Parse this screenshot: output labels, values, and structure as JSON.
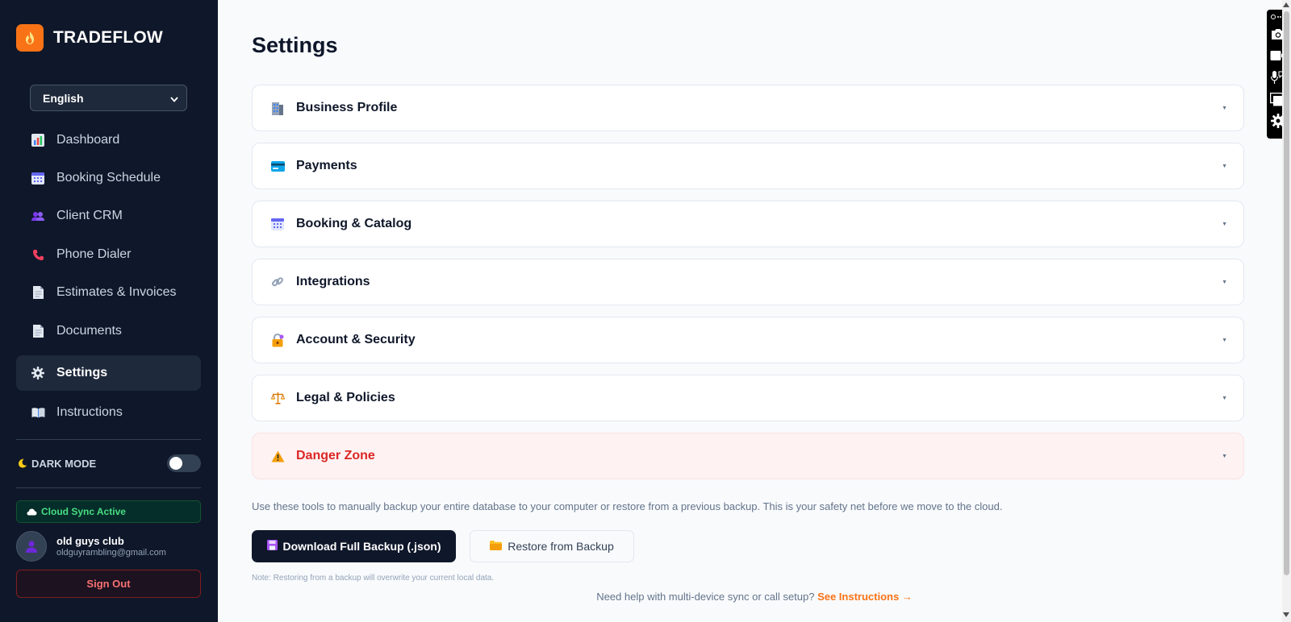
{
  "brand": {
    "name": "TRADEFLOW",
    "icon": "flame-icon"
  },
  "language": {
    "selected": "English"
  },
  "nav": {
    "items": [
      {
        "label": "Dashboard",
        "icon": "bar-chart-icon"
      },
      {
        "label": "Booking Schedule",
        "icon": "calendar-icon"
      },
      {
        "label": "Client CRM",
        "icon": "users-icon"
      },
      {
        "label": "Phone Dialer",
        "icon": "phone-icon"
      },
      {
        "label": "Estimates & Invoices",
        "icon": "document-icon"
      },
      {
        "label": "Documents",
        "icon": "document-icon"
      },
      {
        "label": "Settings",
        "icon": "gear-icon",
        "active": true
      },
      {
        "label": "Instructions",
        "icon": "book-icon"
      }
    ]
  },
  "dark_mode": {
    "label": "DARK MODE",
    "enabled": false
  },
  "sync": {
    "label": "Cloud Sync Active"
  },
  "user": {
    "name": "old guys club",
    "email": "oldguyrambling@gmail.com"
  },
  "signout": {
    "label": "Sign Out"
  },
  "page": {
    "title": "Settings"
  },
  "sections": [
    {
      "label": "Business Profile",
      "icon": "building-icon"
    },
    {
      "label": "Payments",
      "icon": "credit-card-icon"
    },
    {
      "label": "Booking & Catalog",
      "icon": "calendar-icon"
    },
    {
      "label": "Integrations",
      "icon": "link-icon"
    },
    {
      "label": "Account & Security",
      "icon": "lock-icon"
    },
    {
      "label": "Legal & Policies",
      "icon": "scales-icon"
    },
    {
      "label": "Danger Zone",
      "icon": "warning-icon"
    }
  ],
  "backup": {
    "description": "Use these tools to manually backup your entire database to your computer or restore from a previous backup. This is your safety net before we move to the cloud.",
    "download_label": "Download Full Backup (.json)",
    "restore_label": "Restore from Backup",
    "note": "Note: Restoring from a backup will overwrite your current local data."
  },
  "help": {
    "text": "Need help with multi-device sync or call setup?",
    "link": "See Instructions →"
  },
  "colors": {
    "sidebar_bg": "#0f172a",
    "accent": "#f97316",
    "danger": "#dc2626",
    "sync_green": "#4ade80"
  }
}
